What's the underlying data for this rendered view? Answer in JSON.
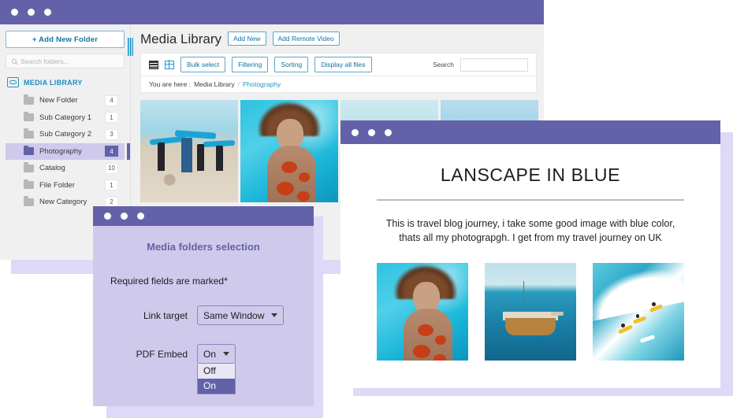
{
  "media_library_window": {
    "titlebar_dots": 3,
    "sidebar": {
      "add_folder_button": "+  Add New Folder",
      "search_placeholder": "Search folders...",
      "search_value": "",
      "library_header": "MEDIA LIBRARY",
      "library_icon": "media-library-logo-icon",
      "folders": [
        {
          "name": "New Folder",
          "count": "4",
          "active": false
        },
        {
          "name": "Sub Category 1",
          "count": "1",
          "active": false
        },
        {
          "name": "Sub Category 2",
          "count": "3",
          "active": false
        },
        {
          "name": "Photography",
          "count": "4",
          "active": true
        },
        {
          "name": "Catalog",
          "count": "10",
          "active": false
        },
        {
          "name": "File Folder",
          "count": "1",
          "active": false
        },
        {
          "name": "New Category",
          "count": "2",
          "active": false
        }
      ]
    },
    "content": {
      "page_title": "Media Library",
      "header_buttons": [
        "Add New",
        "Add Remote Video"
      ],
      "view_icons": [
        "list-view-icon",
        "grid-view-icon"
      ],
      "toolbar_buttons": [
        "Bulk select",
        "Filtering",
        "Sorting",
        "Display all files"
      ],
      "search_label": "Search",
      "search_value": "",
      "search_placeholder": "",
      "breadcrumb": {
        "prefix": "You are here  :",
        "root": "Media Library",
        "separator": "/",
        "current": "Photography"
      },
      "gallery": [
        {
          "alt": "surfers-carrying-boards-on-beach",
          "art": "ph-surf"
        },
        {
          "alt": "woman-underwater-in-floral-dress",
          "art": "ph-under"
        },
        {
          "alt": "pale-blue-sky-thumbnail",
          "art": "ph-sky"
        },
        {
          "alt": "ocean-wave-sky-thumbnail",
          "art": "ph-sky2"
        }
      ]
    }
  },
  "blog_window": {
    "titlebar_dots": 3,
    "title": "LANSCAPE IN BLUE",
    "paragraph": "This is travel blog journey, i take some good image with blue color, thats all my photograpgh. I get from my travel journey on UK",
    "gallery": [
      {
        "alt": "woman-underwater-in-floral-dress",
        "art": "ph-under"
      },
      {
        "alt": "wooden-boats-on-turquoise-sea",
        "art": "ph-boat"
      },
      {
        "alt": "surfers-riding-a-big-wave",
        "art": "ph-wave"
      }
    ]
  },
  "modal_window": {
    "titlebar_dots": 3,
    "title": "Media folders selection",
    "required_note": "Required fields are marked*",
    "fields": [
      {
        "label": "Link target",
        "value": "Same Window",
        "expanded": false,
        "options": [
          "Same Window"
        ]
      },
      {
        "label": "PDF Embed",
        "value": "On",
        "expanded": true,
        "options": [
          "Off",
          "On"
        ],
        "selected_option": "On"
      }
    ]
  },
  "colors": {
    "titlebar_purple": "#6362a8",
    "shadow_lavender": "#ddd9f7",
    "modal_body": "#cfc9ec",
    "accent_blue": "#2196c9",
    "link_blue": "#1173a0",
    "panel_gray": "#f0f0f0"
  }
}
